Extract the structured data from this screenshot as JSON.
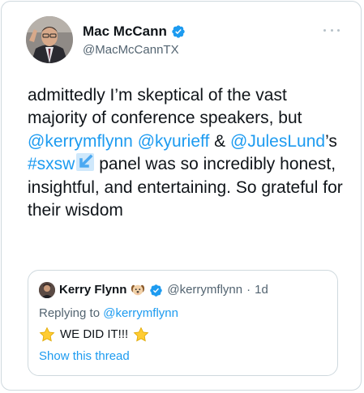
{
  "author": {
    "name": "Mac McCann",
    "handle": "@MacMcCannTX",
    "verified": true
  },
  "tweet": {
    "seg1": "admittedly I’m skeptical of the vast majority of conference speakers, but ",
    "mention1": "@kerrymflynn",
    "seg2": " ",
    "mention2": "@kyurieff",
    "seg3": " & ",
    "mention3": "@JulesLund",
    "seg4": "’s ",
    "hashtag": "#sxsw",
    "seg5": " panel was so incredibly honest, insightful, and entertaining. So grateful for their wisdom"
  },
  "quote": {
    "name": "Kerry Flynn",
    "name_emoji": "dog-face",
    "handle": "@kerrymflynn",
    "separator": "·",
    "time": "1d",
    "replying_prefix": "Replying to ",
    "replying_to": "@kerrymflynn",
    "body": "WE DID IT!!!",
    "show_thread": "Show this thread"
  },
  "colors": {
    "link": "#1d9bf0",
    "verified": "#1d9bf0",
    "muted": "#536471",
    "border": "#cfd9de",
    "text": "#0f1419"
  }
}
